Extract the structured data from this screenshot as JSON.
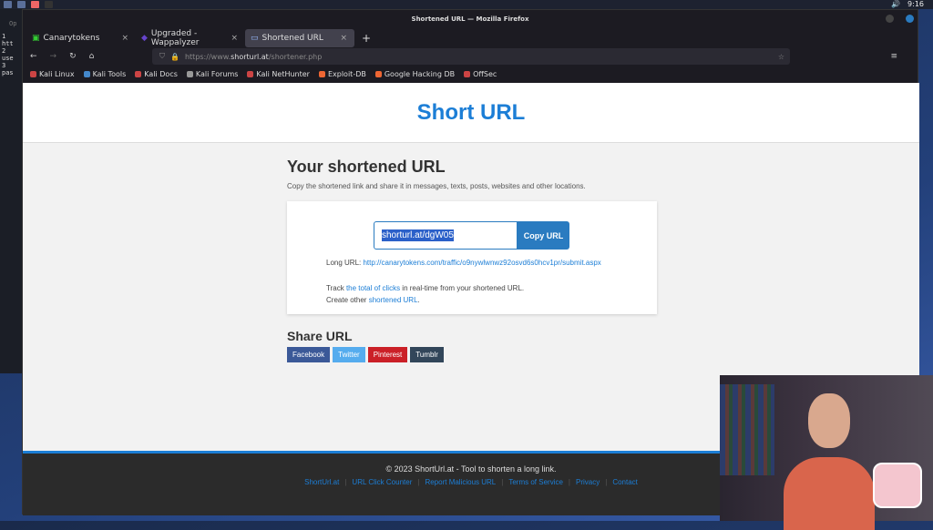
{
  "taskbar": {
    "time": "9:16"
  },
  "terminal": {
    "tab": "Op",
    "lines": [
      "1 htt",
      "2 use",
      "3 pas"
    ]
  },
  "window": {
    "title": "Shortened URL — Mozilla Firefox"
  },
  "tabs": [
    {
      "label": "Canarytokens"
    },
    {
      "label": "Upgraded - Wappalyzer"
    },
    {
      "label": "Shortened URL"
    }
  ],
  "address": {
    "prefix": "https://www.",
    "domain": "shorturl.at",
    "path": "/shortener.php"
  },
  "bookmarks": [
    "Kali Linux",
    "Kali Tools",
    "Kali Docs",
    "Kali Forums",
    "Kali NetHunter",
    "Exploit-DB",
    "Google Hacking DB",
    "OffSec"
  ],
  "page": {
    "logo": "Short URL",
    "title": "Your shortened URL",
    "subtitle": "Copy the shortened link and share it in messages, texts, posts, websites and other locations.",
    "short_url": "shorturl.at/dgW05",
    "copy_label": "Copy URL",
    "long_label": "Long URL:",
    "long_url": "http://canarytokens.com/traffic/o9nywlwnwz92osvd6s0hcv1pr/submit.aspx",
    "track_pre": "Track ",
    "track_link": "the total of clicks",
    "track_post": " in real-time from your shortened URL.",
    "create_pre": "Create other ",
    "create_link": "shortened URL",
    "share_title": "Share URL",
    "share": [
      "Facebook",
      "Twitter",
      "Pinterest",
      "Tumblr"
    ]
  },
  "footer": {
    "copyright": "© 2023 ShortUrl.at - Tool to shorten a long link.",
    "links": [
      "ShortUrl.at",
      "URL Click Counter",
      "Report Malicious URL",
      "Terms of Service",
      "Privacy",
      "Contact"
    ]
  },
  "colors": {
    "accent": "#1c7ed6",
    "facebook": "#3b5998",
    "twitter": "#55acee",
    "pinterest": "#cb2027",
    "tumblr": "#32465a"
  }
}
